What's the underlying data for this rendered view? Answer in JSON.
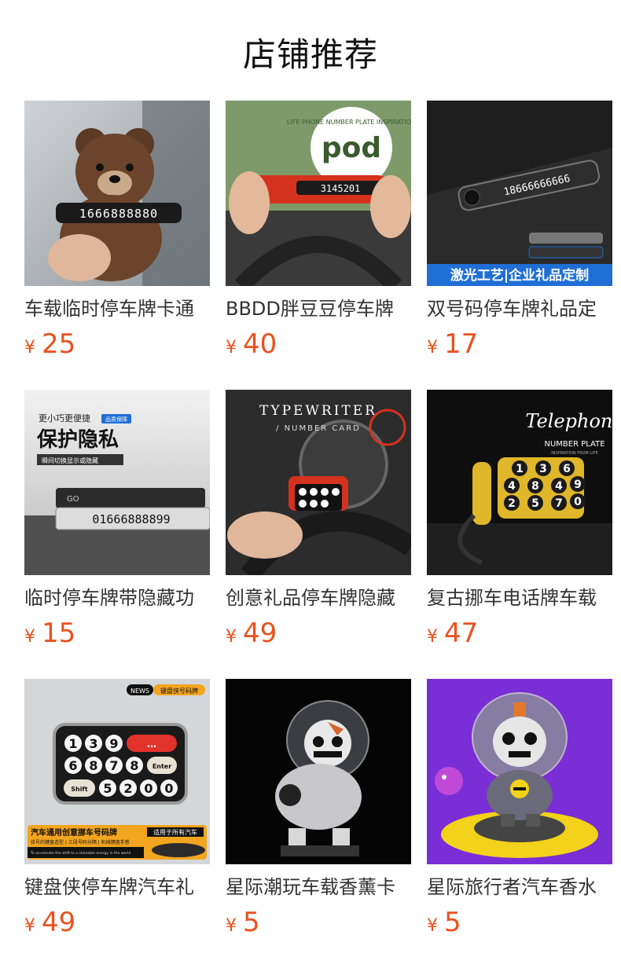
{
  "header": {
    "title": "店铺推荐"
  },
  "products": [
    {
      "title": "车载临时停车牌卡通",
      "currency": "¥",
      "price": "25",
      "image_caption": "",
      "image_icon": "bear-number-plate-image"
    },
    {
      "title": "BBDD胖豆豆停车牌",
      "currency": "¥",
      "price": "40",
      "image_caption": "",
      "image_icon": "pod-number-plate-image"
    },
    {
      "title": "双号码停车牌礼品定",
      "currency": "¥",
      "price": "17",
      "image_caption": "激光工艺|企业礼品定制",
      "image_icon": "dual-number-plate-image"
    },
    {
      "title": "临时停车牌带隐藏功",
      "currency": "¥",
      "price": "15",
      "image_caption": "",
      "image_icon": "privacy-number-plate-image"
    },
    {
      "title": "创意礼品停车牌隐藏",
      "currency": "¥",
      "price": "49",
      "image_caption": "",
      "image_icon": "typewriter-number-plate-image"
    },
    {
      "title": "复古挪车电话牌车载",
      "currency": "¥",
      "price": "47",
      "image_caption": "",
      "image_icon": "telephone-number-plate-image"
    },
    {
      "title": "键盘侠停车牌汽车礼",
      "currency": "¥",
      "price": "49",
      "image_caption": "",
      "image_icon": "keyboard-number-plate-image"
    },
    {
      "title": "星际潮玩车载香薰卡",
      "currency": "¥",
      "price": "5",
      "image_caption": "",
      "image_icon": "astronaut-aroma-image"
    },
    {
      "title": "星际旅行者汽车香水",
      "currency": "¥",
      "price": "5",
      "image_caption": "",
      "image_icon": "astronaut-purple-image"
    }
  ],
  "image_text": {
    "p1_plate": "1666888880",
    "p2_badge": "pod",
    "p2_ring": "LIFE PHONE NUMBER PLATE INSPIRATION",
    "p2_digits": "3145201",
    "p3_digits": "18666666666",
    "p4_top": "更小巧更便捷",
    "p4_tag": "品质保障",
    "p4_title": "保护隐私",
    "p4_sub": "瞬间切换显示或隐藏",
    "p4_go": "GO",
    "p4_digits": "01666888899",
    "p5_title": "TYPEWRITER",
    "p5_sub": "/ NUMBER CARD",
    "p6_title": "Telephone",
    "p6_sub": "NUMBER PLATE",
    "p6_sub2": "INSPIRATION FROM LIFE",
    "p6_keys": [
      "1",
      "3",
      "6",
      "4",
      "8",
      "4",
      "9",
      "2",
      "5",
      "7",
      "0"
    ],
    "p7_news": "NEWS",
    "p7_badge": "键盘侠号码牌",
    "p7_keys": [
      "1",
      "3",
      "9",
      "6",
      "8",
      "7",
      "8",
      "5",
      "2",
      "0",
      "0"
    ],
    "p7_enter": "Enter",
    "p7_shift": "Shift",
    "p7_call": "…",
    "p7_title": "汽车通用创意挪车号码牌",
    "p7_sub": "适用于所有汽车",
    "p7_desc": "炫号的键盘造型 | 三段号码分隔 | 机械键盘手感",
    "p7_en": "To accelerate the shift to a stainable energy in the world"
  },
  "colors": {
    "price": "#e8521f",
    "caption_bg": "#1f6fd6"
  }
}
